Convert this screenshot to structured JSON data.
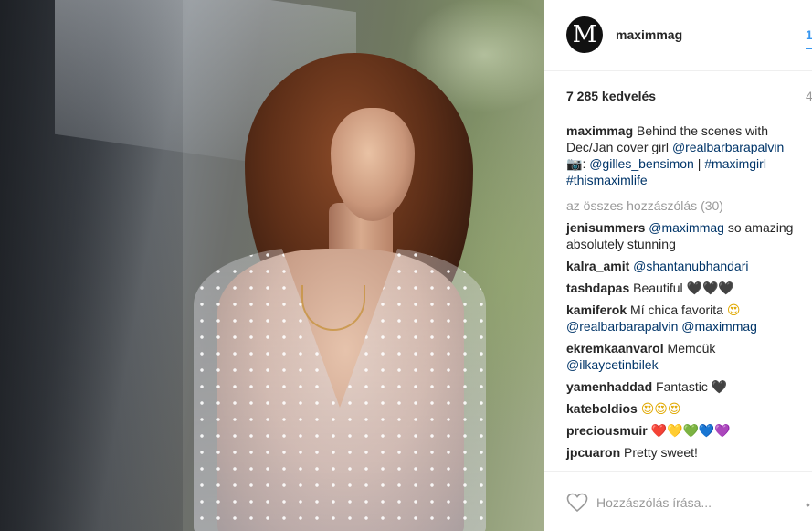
{
  "post": {
    "username": "maximmag",
    "avatar_letter": "M",
    "follow_fragment": "1",
    "likes": "7 285 kedvelés",
    "date_fragment": "4",
    "caption": {
      "user": "maximmag",
      "text_before": " Behind the scenes with Dec/Jan cover girl ",
      "mention1": "@realbarbarapalvin",
      "camera_emoji": "📷",
      "text_mid": ": ",
      "mention2": "@gilles_bensimon",
      "sep": " | ",
      "hashtag1": "#maximgirl",
      "hashtag2": "#thismaximlife"
    },
    "all_comments": "az összes hozzászólás (30)",
    "comments": [
      {
        "user": "jenisummers",
        "link": "@maximmag",
        "text": " so amazing absolutely stunning"
      },
      {
        "user": "kalra_amit",
        "link": "@shantanubhandari",
        "text": ""
      },
      {
        "user": "tashdapas",
        "text": " Beautiful ",
        "emoji": "🖤🖤🖤"
      },
      {
        "user": "kamiferok",
        "text": " Mí chica favorita ",
        "emoji": "😍",
        "link1": "@realbarbarapalvin",
        "link2": "@maximmag"
      },
      {
        "user": "ekremkaanvarol",
        "text": " Memcük ",
        "link": "@ilkaycetinbilek"
      },
      {
        "user": "yamenhaddad",
        "text": " Fantastic ",
        "emoji": "🖤"
      },
      {
        "user": "kateboldios",
        "emoji": "😍😍😍"
      },
      {
        "user": "preciousmuir",
        "emoji": "❤️💛💚💙💜"
      },
      {
        "user": "jpcuaron",
        "text": " Pretty sweet!"
      }
    ],
    "comment_placeholder": "Hozzászólás írása...",
    "more_fragment": "•"
  },
  "colors": {
    "link": "#003569",
    "accent": "#3897f0",
    "muted": "#999999"
  },
  "icons": [
    "heart-outline-icon",
    "camera-icon"
  ]
}
